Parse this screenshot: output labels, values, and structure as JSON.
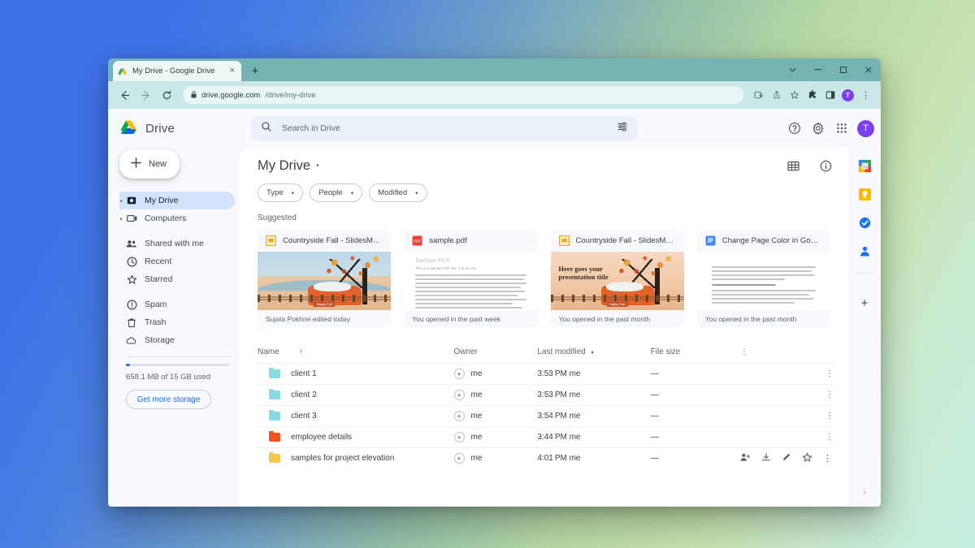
{
  "browser": {
    "tab": {
      "title": "My Drive - Google Drive",
      "favicon": "drive-icon",
      "close": "×"
    },
    "new_tab_label": "+",
    "window_controls": {
      "tab_search": "⌄",
      "minimize": "–",
      "maximize": "□",
      "close": "×"
    },
    "nav": {
      "back": "←",
      "forward": "→",
      "reload": "↻"
    },
    "url": {
      "lock": "🔒",
      "domain": "drive.google.com",
      "path": "/drive/my-drive"
    },
    "toolbar": {
      "install": "install-icon",
      "share": "share-icon",
      "bookmark": "☆",
      "extensions": "puzzle-icon",
      "side_panel": "panel-icon",
      "profile_initial": "T",
      "menu": "⋮"
    }
  },
  "drive": {
    "brand": "Drive",
    "search": {
      "placeholder": "Search in Drive",
      "value": "",
      "icon": "search-icon",
      "tune": "tune-icon"
    },
    "header_actions": {
      "help": "?",
      "settings": "gear-icon",
      "apps": "apps-grid-icon",
      "avatar": "T"
    },
    "page": {
      "title": "My Drive",
      "caret": "▾",
      "grid_view": "grid-view-icon",
      "details": "info-icon"
    },
    "chips": [
      {
        "label": "Type",
        "caret": "▾"
      },
      {
        "label": "People",
        "caret": "▾"
      },
      {
        "label": "Modified",
        "caret": "▾"
      }
    ],
    "suggested_label": "Suggested",
    "cards": [
      {
        "title": "Countryside Fall - SlidesMa…",
        "icon": "slides-icon",
        "footer": "Sujata Pokhrel edited today",
        "thumb": "fall-scene"
      },
      {
        "title": "sample.pdf",
        "icon": "pdf-icon",
        "footer": "You opened in the past week",
        "thumb": "pdf-page",
        "thumb_title": "Sample PDF",
        "thumb_sub": "This is a sample PDF file. Fun fun fun."
      },
      {
        "title": "Countryside Fall - SlidesMa…",
        "icon": "slides-icon",
        "footer": "You opened in the past month",
        "thumb": "fall-title",
        "thumb_heading": "Here goes your presentation title"
      },
      {
        "title": "Change Page Color in Goo…",
        "icon": "docs-icon",
        "footer": "You opened in the past month",
        "thumb": "doc-page"
      }
    ],
    "table": {
      "columns": {
        "name": "Name",
        "name_sort": "↑",
        "owner": "Owner",
        "modified": "Last modified",
        "modified_caret": "▾",
        "size": "File size",
        "menu": "⋮"
      },
      "rows": [
        {
          "name": "client 1",
          "icon": "folder-icon",
          "color": "#8ad9e0",
          "owner": "me",
          "modified": "3:53 PM me",
          "size": "—",
          "menu": "⋮",
          "hover": false
        },
        {
          "name": "client 2",
          "icon": "folder-icon",
          "color": "#8ad9e0",
          "owner": "me",
          "modified": "3:53 PM me",
          "size": "—",
          "menu": "⋮",
          "hover": false
        },
        {
          "name": "client 3",
          "icon": "folder-icon",
          "color": "#8ad9e0",
          "owner": "me",
          "modified": "3:54 PM me",
          "size": "—",
          "menu": "⋮",
          "hover": false
        },
        {
          "name": "employee details",
          "icon": "folder-icon",
          "color": "#f4511e",
          "owner": "me",
          "modified": "3:44 PM me",
          "size": "—",
          "menu": "⋮",
          "hover": false
        },
        {
          "name": "samples for project elevation",
          "icon": "folder-icon",
          "color": "#f5c84c",
          "owner": "me",
          "modified": "4:01 PM me",
          "size": "—",
          "menu": "⋮",
          "hover": true
        }
      ],
      "hover_actions": {
        "share": "add-person-icon",
        "download": "download-icon",
        "edit": "pen-icon",
        "star": "☆",
        "menu": "⋮"
      }
    },
    "sidebar": {
      "new_button": {
        "label": "New",
        "plus": "+"
      },
      "items": [
        {
          "label": "My Drive",
          "icon": "my-drive-icon",
          "active": true,
          "expandable": true
        },
        {
          "label": "Computers",
          "icon": "computers-icon",
          "active": false,
          "expandable": true
        },
        {
          "label": "Shared with me",
          "icon": "shared-icon",
          "active": false,
          "expandable": false
        },
        {
          "label": "Recent",
          "icon": "clock-icon",
          "active": false,
          "expandable": false
        },
        {
          "label": "Starred",
          "icon": "star-icon",
          "active": false,
          "expandable": false
        },
        {
          "label": "Spam",
          "icon": "spam-icon",
          "active": false,
          "expandable": false
        },
        {
          "label": "Trash",
          "icon": "trash-icon",
          "active": false,
          "expandable": false
        },
        {
          "label": "Storage",
          "icon": "cloud-icon",
          "active": false,
          "expandable": false
        }
      ],
      "storage_text": "658.1 MB of 15 GB used",
      "storage_percent": 4,
      "storage_button": "Get more storage"
    },
    "rail": {
      "apps": [
        "calendar-icon",
        "keep-icon",
        "tasks-icon",
        "contacts-icon"
      ],
      "add": "+",
      "expand": "›"
    }
  },
  "colors": {
    "accent": "#1a73e8",
    "active_nav": "#d3e3fd",
    "profile": "#7b3ff2",
    "titlebar": "#73b3b3"
  }
}
